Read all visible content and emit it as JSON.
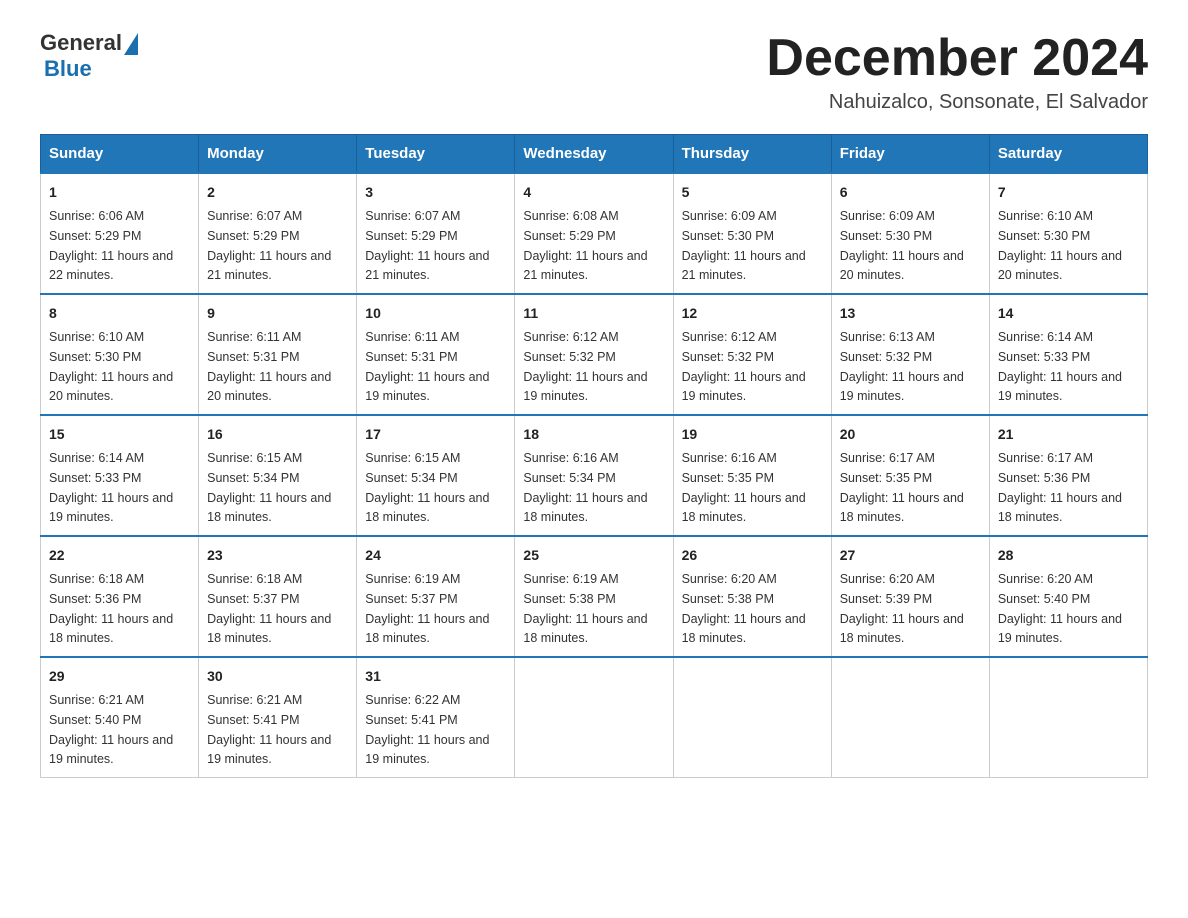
{
  "header": {
    "logo": {
      "general": "General",
      "blue": "Blue"
    },
    "title": "December 2024",
    "location": "Nahuizalco, Sonsonate, El Salvador"
  },
  "calendar": {
    "days_of_week": [
      "Sunday",
      "Monday",
      "Tuesday",
      "Wednesday",
      "Thursday",
      "Friday",
      "Saturday"
    ],
    "weeks": [
      [
        {
          "day": "1",
          "sunrise": "Sunrise: 6:06 AM",
          "sunset": "Sunset: 5:29 PM",
          "daylight": "Daylight: 11 hours and 22 minutes."
        },
        {
          "day": "2",
          "sunrise": "Sunrise: 6:07 AM",
          "sunset": "Sunset: 5:29 PM",
          "daylight": "Daylight: 11 hours and 21 minutes."
        },
        {
          "day": "3",
          "sunrise": "Sunrise: 6:07 AM",
          "sunset": "Sunset: 5:29 PM",
          "daylight": "Daylight: 11 hours and 21 minutes."
        },
        {
          "day": "4",
          "sunrise": "Sunrise: 6:08 AM",
          "sunset": "Sunset: 5:29 PM",
          "daylight": "Daylight: 11 hours and 21 minutes."
        },
        {
          "day": "5",
          "sunrise": "Sunrise: 6:09 AM",
          "sunset": "Sunset: 5:30 PM",
          "daylight": "Daylight: 11 hours and 21 minutes."
        },
        {
          "day": "6",
          "sunrise": "Sunrise: 6:09 AM",
          "sunset": "Sunset: 5:30 PM",
          "daylight": "Daylight: 11 hours and 20 minutes."
        },
        {
          "day": "7",
          "sunrise": "Sunrise: 6:10 AM",
          "sunset": "Sunset: 5:30 PM",
          "daylight": "Daylight: 11 hours and 20 minutes."
        }
      ],
      [
        {
          "day": "8",
          "sunrise": "Sunrise: 6:10 AM",
          "sunset": "Sunset: 5:30 PM",
          "daylight": "Daylight: 11 hours and 20 minutes."
        },
        {
          "day": "9",
          "sunrise": "Sunrise: 6:11 AM",
          "sunset": "Sunset: 5:31 PM",
          "daylight": "Daylight: 11 hours and 20 minutes."
        },
        {
          "day": "10",
          "sunrise": "Sunrise: 6:11 AM",
          "sunset": "Sunset: 5:31 PM",
          "daylight": "Daylight: 11 hours and 19 minutes."
        },
        {
          "day": "11",
          "sunrise": "Sunrise: 6:12 AM",
          "sunset": "Sunset: 5:32 PM",
          "daylight": "Daylight: 11 hours and 19 minutes."
        },
        {
          "day": "12",
          "sunrise": "Sunrise: 6:12 AM",
          "sunset": "Sunset: 5:32 PM",
          "daylight": "Daylight: 11 hours and 19 minutes."
        },
        {
          "day": "13",
          "sunrise": "Sunrise: 6:13 AM",
          "sunset": "Sunset: 5:32 PM",
          "daylight": "Daylight: 11 hours and 19 minutes."
        },
        {
          "day": "14",
          "sunrise": "Sunrise: 6:14 AM",
          "sunset": "Sunset: 5:33 PM",
          "daylight": "Daylight: 11 hours and 19 minutes."
        }
      ],
      [
        {
          "day": "15",
          "sunrise": "Sunrise: 6:14 AM",
          "sunset": "Sunset: 5:33 PM",
          "daylight": "Daylight: 11 hours and 19 minutes."
        },
        {
          "day": "16",
          "sunrise": "Sunrise: 6:15 AM",
          "sunset": "Sunset: 5:34 PM",
          "daylight": "Daylight: 11 hours and 18 minutes."
        },
        {
          "day": "17",
          "sunrise": "Sunrise: 6:15 AM",
          "sunset": "Sunset: 5:34 PM",
          "daylight": "Daylight: 11 hours and 18 minutes."
        },
        {
          "day": "18",
          "sunrise": "Sunrise: 6:16 AM",
          "sunset": "Sunset: 5:34 PM",
          "daylight": "Daylight: 11 hours and 18 minutes."
        },
        {
          "day": "19",
          "sunrise": "Sunrise: 6:16 AM",
          "sunset": "Sunset: 5:35 PM",
          "daylight": "Daylight: 11 hours and 18 minutes."
        },
        {
          "day": "20",
          "sunrise": "Sunrise: 6:17 AM",
          "sunset": "Sunset: 5:35 PM",
          "daylight": "Daylight: 11 hours and 18 minutes."
        },
        {
          "day": "21",
          "sunrise": "Sunrise: 6:17 AM",
          "sunset": "Sunset: 5:36 PM",
          "daylight": "Daylight: 11 hours and 18 minutes."
        }
      ],
      [
        {
          "day": "22",
          "sunrise": "Sunrise: 6:18 AM",
          "sunset": "Sunset: 5:36 PM",
          "daylight": "Daylight: 11 hours and 18 minutes."
        },
        {
          "day": "23",
          "sunrise": "Sunrise: 6:18 AM",
          "sunset": "Sunset: 5:37 PM",
          "daylight": "Daylight: 11 hours and 18 minutes."
        },
        {
          "day": "24",
          "sunrise": "Sunrise: 6:19 AM",
          "sunset": "Sunset: 5:37 PM",
          "daylight": "Daylight: 11 hours and 18 minutes."
        },
        {
          "day": "25",
          "sunrise": "Sunrise: 6:19 AM",
          "sunset": "Sunset: 5:38 PM",
          "daylight": "Daylight: 11 hours and 18 minutes."
        },
        {
          "day": "26",
          "sunrise": "Sunrise: 6:20 AM",
          "sunset": "Sunset: 5:38 PM",
          "daylight": "Daylight: 11 hours and 18 minutes."
        },
        {
          "day": "27",
          "sunrise": "Sunrise: 6:20 AM",
          "sunset": "Sunset: 5:39 PM",
          "daylight": "Daylight: 11 hours and 18 minutes."
        },
        {
          "day": "28",
          "sunrise": "Sunrise: 6:20 AM",
          "sunset": "Sunset: 5:40 PM",
          "daylight": "Daylight: 11 hours and 19 minutes."
        }
      ],
      [
        {
          "day": "29",
          "sunrise": "Sunrise: 6:21 AM",
          "sunset": "Sunset: 5:40 PM",
          "daylight": "Daylight: 11 hours and 19 minutes."
        },
        {
          "day": "30",
          "sunrise": "Sunrise: 6:21 AM",
          "sunset": "Sunset: 5:41 PM",
          "daylight": "Daylight: 11 hours and 19 minutes."
        },
        {
          "day": "31",
          "sunrise": "Sunrise: 6:22 AM",
          "sunset": "Sunset: 5:41 PM",
          "daylight": "Daylight: 11 hours and 19 minutes."
        },
        {
          "day": "",
          "sunrise": "",
          "sunset": "",
          "daylight": ""
        },
        {
          "day": "",
          "sunrise": "",
          "sunset": "",
          "daylight": ""
        },
        {
          "day": "",
          "sunrise": "",
          "sunset": "",
          "daylight": ""
        },
        {
          "day": "",
          "sunrise": "",
          "sunset": "",
          "daylight": ""
        }
      ]
    ]
  }
}
